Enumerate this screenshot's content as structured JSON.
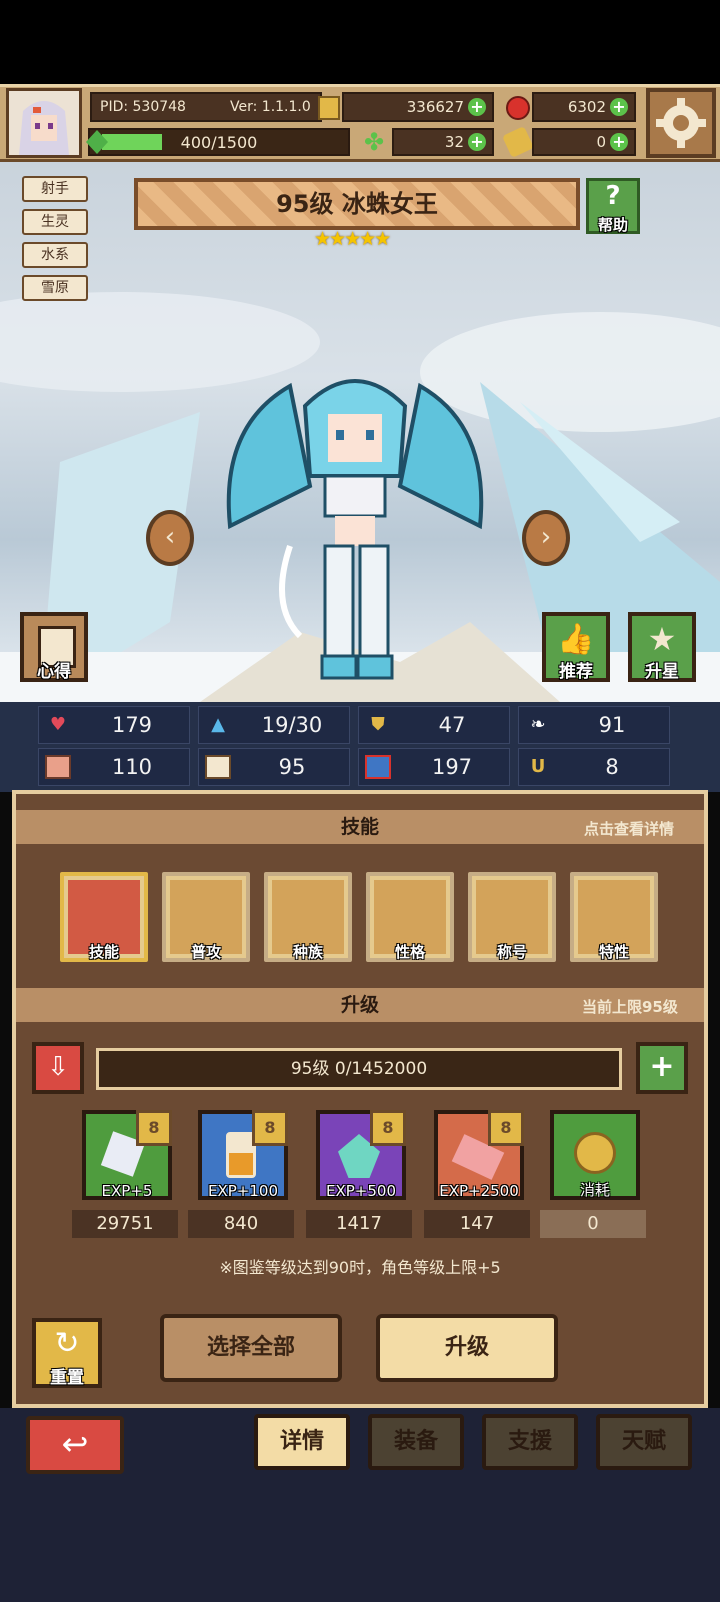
{
  "header": {
    "pid": "PID: 530748",
    "version": "Ver: 1.1.1.0",
    "gold": "336627",
    "gems": "6302",
    "stamina": "400/1500",
    "stamina_fraction": 0.2667,
    "clover": "32",
    "tickets": "0"
  },
  "character": {
    "tags": [
      "射手",
      "生灵",
      "水系",
      "雪原"
    ],
    "title": "95级 冰蛛女王",
    "stars": "★★★★★",
    "help_label": "帮助",
    "left_button": "心得",
    "recommend_button": "推荐",
    "star_up_button": "升星"
  },
  "stats": [
    {
      "icon": "heart-icon",
      "value": "179"
    },
    {
      "icon": "drop-icon",
      "value": "19/30"
    },
    {
      "icon": "shield-icon",
      "value": "47"
    },
    {
      "icon": "wing-icon",
      "value": "91"
    },
    {
      "icon": "fist-icon",
      "value": "110"
    },
    {
      "icon": "book-icon",
      "value": "95"
    },
    {
      "icon": "scroll-icon",
      "value": "197"
    },
    {
      "icon": "horseshoe-icon",
      "value": "8"
    }
  ],
  "skills_section": {
    "title": "技能",
    "hint": "点击查看详情",
    "items": [
      "技能",
      "普攻",
      "种族",
      "性格",
      "称号",
      "特性"
    ]
  },
  "upgrade_section": {
    "title": "升级",
    "hint": "当前上限95级",
    "exp_bar": "95级 0/1452000",
    "items": [
      {
        "label": "EXP+5",
        "count": "29751",
        "color": "#4f9c3e"
      },
      {
        "label": "EXP+100",
        "count": "840",
        "color": "#3f76c4"
      },
      {
        "label": "EXP+500",
        "count": "1417",
        "color": "#7a44b8"
      },
      {
        "label": "EXP+2500",
        "count": "147",
        "color": "#d46b4a"
      },
      {
        "label": "消耗",
        "count": "0",
        "color": "#4f9c3e"
      }
    ],
    "note": "※图鉴等级达到90时，角色等级上限+5",
    "reset_label": "重置",
    "select_all_label": "选择全部",
    "upgrade_label": "升级"
  },
  "tabs": [
    "详情",
    "装备",
    "支援",
    "天赋"
  ],
  "colors": {
    "panel": "#6b4a33",
    "accent_gold": "#e2b848",
    "plus_green": "#5cc24a",
    "back_red": "#d94a42"
  }
}
